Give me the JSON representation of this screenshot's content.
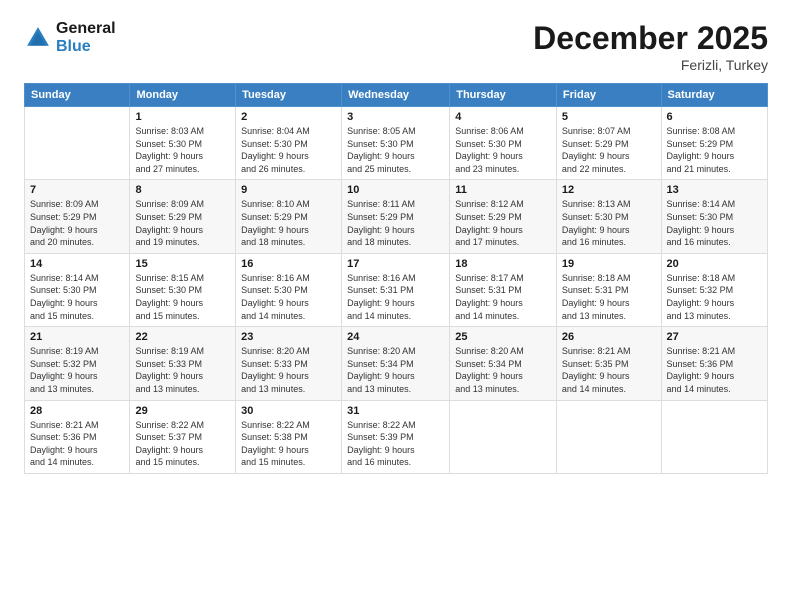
{
  "logo": {
    "line1": "General",
    "line2": "Blue"
  },
  "header": {
    "month": "December 2025",
    "location": "Ferizli, Turkey"
  },
  "days_of_week": [
    "Sunday",
    "Monday",
    "Tuesday",
    "Wednesday",
    "Thursday",
    "Friday",
    "Saturday"
  ],
  "weeks": [
    [
      {
        "num": "",
        "info": ""
      },
      {
        "num": "1",
        "info": "Sunrise: 8:03 AM\nSunset: 5:30 PM\nDaylight: 9 hours\nand 27 minutes."
      },
      {
        "num": "2",
        "info": "Sunrise: 8:04 AM\nSunset: 5:30 PM\nDaylight: 9 hours\nand 26 minutes."
      },
      {
        "num": "3",
        "info": "Sunrise: 8:05 AM\nSunset: 5:30 PM\nDaylight: 9 hours\nand 25 minutes."
      },
      {
        "num": "4",
        "info": "Sunrise: 8:06 AM\nSunset: 5:30 PM\nDaylight: 9 hours\nand 23 minutes."
      },
      {
        "num": "5",
        "info": "Sunrise: 8:07 AM\nSunset: 5:29 PM\nDaylight: 9 hours\nand 22 minutes."
      },
      {
        "num": "6",
        "info": "Sunrise: 8:08 AM\nSunset: 5:29 PM\nDaylight: 9 hours\nand 21 minutes."
      }
    ],
    [
      {
        "num": "7",
        "info": "Sunrise: 8:09 AM\nSunset: 5:29 PM\nDaylight: 9 hours\nand 20 minutes."
      },
      {
        "num": "8",
        "info": "Sunrise: 8:09 AM\nSunset: 5:29 PM\nDaylight: 9 hours\nand 19 minutes."
      },
      {
        "num": "9",
        "info": "Sunrise: 8:10 AM\nSunset: 5:29 PM\nDaylight: 9 hours\nand 18 minutes."
      },
      {
        "num": "10",
        "info": "Sunrise: 8:11 AM\nSunset: 5:29 PM\nDaylight: 9 hours\nand 18 minutes."
      },
      {
        "num": "11",
        "info": "Sunrise: 8:12 AM\nSunset: 5:29 PM\nDaylight: 9 hours\nand 17 minutes."
      },
      {
        "num": "12",
        "info": "Sunrise: 8:13 AM\nSunset: 5:30 PM\nDaylight: 9 hours\nand 16 minutes."
      },
      {
        "num": "13",
        "info": "Sunrise: 8:14 AM\nSunset: 5:30 PM\nDaylight: 9 hours\nand 16 minutes."
      }
    ],
    [
      {
        "num": "14",
        "info": "Sunrise: 8:14 AM\nSunset: 5:30 PM\nDaylight: 9 hours\nand 15 minutes."
      },
      {
        "num": "15",
        "info": "Sunrise: 8:15 AM\nSunset: 5:30 PM\nDaylight: 9 hours\nand 15 minutes."
      },
      {
        "num": "16",
        "info": "Sunrise: 8:16 AM\nSunset: 5:30 PM\nDaylight: 9 hours\nand 14 minutes."
      },
      {
        "num": "17",
        "info": "Sunrise: 8:16 AM\nSunset: 5:31 PM\nDaylight: 9 hours\nand 14 minutes."
      },
      {
        "num": "18",
        "info": "Sunrise: 8:17 AM\nSunset: 5:31 PM\nDaylight: 9 hours\nand 14 minutes."
      },
      {
        "num": "19",
        "info": "Sunrise: 8:18 AM\nSunset: 5:31 PM\nDaylight: 9 hours\nand 13 minutes."
      },
      {
        "num": "20",
        "info": "Sunrise: 8:18 AM\nSunset: 5:32 PM\nDaylight: 9 hours\nand 13 minutes."
      }
    ],
    [
      {
        "num": "21",
        "info": "Sunrise: 8:19 AM\nSunset: 5:32 PM\nDaylight: 9 hours\nand 13 minutes."
      },
      {
        "num": "22",
        "info": "Sunrise: 8:19 AM\nSunset: 5:33 PM\nDaylight: 9 hours\nand 13 minutes."
      },
      {
        "num": "23",
        "info": "Sunrise: 8:20 AM\nSunset: 5:33 PM\nDaylight: 9 hours\nand 13 minutes."
      },
      {
        "num": "24",
        "info": "Sunrise: 8:20 AM\nSunset: 5:34 PM\nDaylight: 9 hours\nand 13 minutes."
      },
      {
        "num": "25",
        "info": "Sunrise: 8:20 AM\nSunset: 5:34 PM\nDaylight: 9 hours\nand 13 minutes."
      },
      {
        "num": "26",
        "info": "Sunrise: 8:21 AM\nSunset: 5:35 PM\nDaylight: 9 hours\nand 14 minutes."
      },
      {
        "num": "27",
        "info": "Sunrise: 8:21 AM\nSunset: 5:36 PM\nDaylight: 9 hours\nand 14 minutes."
      }
    ],
    [
      {
        "num": "28",
        "info": "Sunrise: 8:21 AM\nSunset: 5:36 PM\nDaylight: 9 hours\nand 14 minutes."
      },
      {
        "num": "29",
        "info": "Sunrise: 8:22 AM\nSunset: 5:37 PM\nDaylight: 9 hours\nand 15 minutes."
      },
      {
        "num": "30",
        "info": "Sunrise: 8:22 AM\nSunset: 5:38 PM\nDaylight: 9 hours\nand 15 minutes."
      },
      {
        "num": "31",
        "info": "Sunrise: 8:22 AM\nSunset: 5:39 PM\nDaylight: 9 hours\nand 16 minutes."
      },
      {
        "num": "",
        "info": ""
      },
      {
        "num": "",
        "info": ""
      },
      {
        "num": "",
        "info": ""
      }
    ]
  ]
}
